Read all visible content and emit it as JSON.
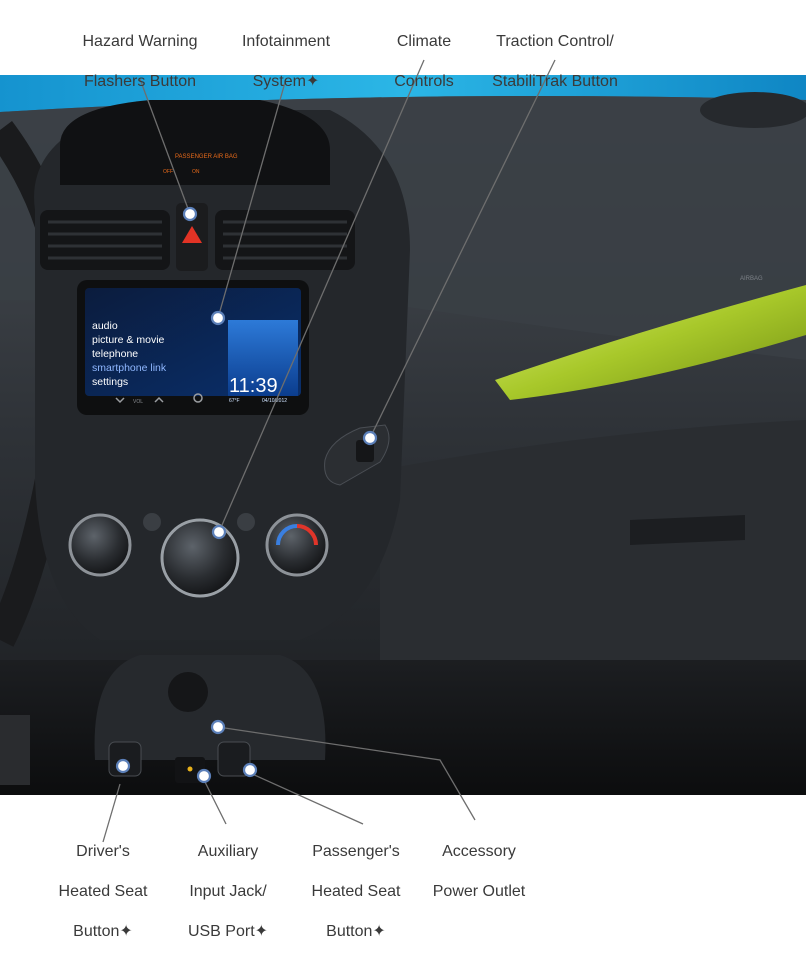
{
  "top_labels": [
    {
      "name": "hazard",
      "lines": [
        "Hazard Warning",
        "Flashers Button"
      ]
    },
    {
      "name": "infotainment",
      "lines": [
        "Infotainment",
        "System✦"
      ]
    },
    {
      "name": "climate",
      "lines": [
        "Climate",
        "Controls"
      ]
    },
    {
      "name": "traction",
      "lines": [
        "Traction Control/",
        "StabiliTrak Button"
      ]
    }
  ],
  "bottom_labels": [
    {
      "name": "driver-seat",
      "lines": [
        "Driver's",
        "Heated Seat",
        "Button✦"
      ]
    },
    {
      "name": "aux",
      "lines": [
        "Auxiliary",
        "Input Jack/",
        "USB Port✦"
      ]
    },
    {
      "name": "passenger-seat",
      "lines": [
        "Passenger's",
        "Heated Seat",
        "Button✦"
      ]
    },
    {
      "name": "power-outlet",
      "lines": [
        "Accessory",
        "Power Outlet"
      ]
    }
  ],
  "screen": {
    "menu": [
      "audio",
      "picture & movie",
      "telephone",
      "smartphone link",
      "settings"
    ],
    "time": "11:39",
    "temp": "67°F",
    "date": "04/10/2012",
    "controls": [
      "VOL"
    ]
  },
  "display_text": [
    "PASSENGER AIR BAG",
    "OFF",
    "ON"
  ],
  "airbag_text": "AIRBAG",
  "colors": {
    "accent_blue": "#1aa3d8",
    "lime": "#a8c82a",
    "dash": "#2c2f33",
    "line": "#6e6e6e"
  }
}
